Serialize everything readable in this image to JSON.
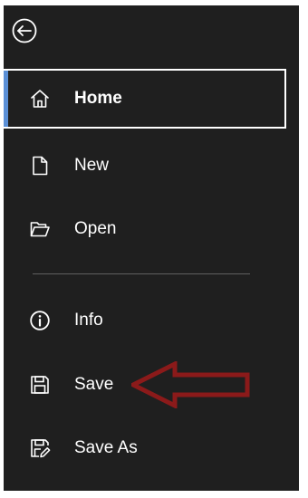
{
  "backstage": {
    "back_icon": "back-arrow-circle-icon",
    "accent_color": "#5a8fd6",
    "background_color": "#1f1f1f",
    "items": [
      {
        "label": "Home",
        "icon": "home-icon",
        "selected": true
      },
      {
        "label": "New",
        "icon": "new-document-icon",
        "selected": false
      },
      {
        "label": "Open",
        "icon": "open-folder-icon",
        "selected": false
      },
      {
        "label": "Info",
        "icon": "info-icon",
        "selected": false
      },
      {
        "label": "Save",
        "icon": "save-icon",
        "selected": false
      },
      {
        "label": "Save As",
        "icon": "save-as-icon",
        "selected": false
      }
    ]
  },
  "annotation": {
    "arrow_color": "#8b1a1a",
    "points_to": "Save"
  }
}
